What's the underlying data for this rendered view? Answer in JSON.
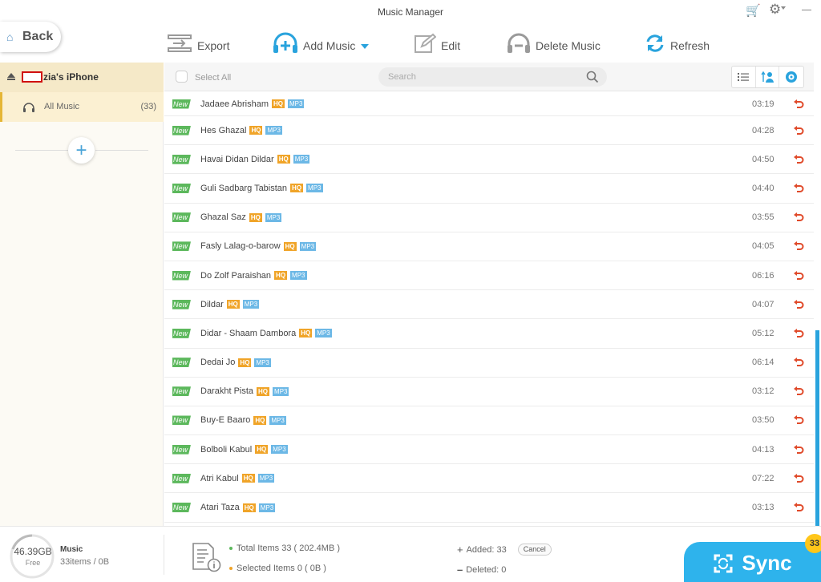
{
  "window": {
    "title": "Music Manager"
  },
  "nav": {
    "back_label": "Back"
  },
  "toolbar": {
    "export_label": "Export",
    "add_music_label": "Add Music",
    "edit_label": "Edit",
    "delete_music_label": "Delete Music",
    "refresh_label": "Refresh"
  },
  "sidebar": {
    "device_name": "zia's iPhone",
    "category_label": "All Music",
    "category_count": "(33)"
  },
  "list_header": {
    "select_all_label": "Select All",
    "search_placeholder": "Search"
  },
  "badges": {
    "new": "New",
    "hq": "HQ",
    "mp3": "MP3"
  },
  "songs": [
    {
      "title": "Jadaee Abrisham",
      "duration": "03:19"
    },
    {
      "title": "Hes Ghazal",
      "duration": "04:28"
    },
    {
      "title": "Havai Didan Dildar",
      "duration": "04:50"
    },
    {
      "title": "Guli Sadbarg Tabistan",
      "duration": "04:40"
    },
    {
      "title": "Ghazal Saz",
      "duration": "03:55"
    },
    {
      "title": "Fasly Lalag-o-barow",
      "duration": "04:05"
    },
    {
      "title": "Do Zolf Paraishan",
      "duration": "06:16"
    },
    {
      "title": "Dildar",
      "duration": "04:07"
    },
    {
      "title": "Didar - Shaam Dambora",
      "duration": "05:12"
    },
    {
      "title": "Dedai Jo",
      "duration": "06:14"
    },
    {
      "title": "Darakht Pista",
      "duration": "03:12"
    },
    {
      "title": "Buy-E Baaro",
      "duration": "03:50"
    },
    {
      "title": "Bolboli Kabul",
      "duration": "04:13"
    },
    {
      "title": "Atri Kabul",
      "duration": "07:22"
    },
    {
      "title": "Atari Taza",
      "duration": "03:13"
    }
  ],
  "footer": {
    "storage_amount": "46.39GB",
    "storage_label": "Free",
    "music_title": "Music",
    "music_sub": "33items / 0B",
    "total_items": "Total Items 33 ( 202.4MB )",
    "selected_items": "Selected Items 0 ( 0B )",
    "added": "Added: 33",
    "cancel_label": "Cancel",
    "deleted": "Deleted: 0",
    "sync_label": "Sync",
    "sync_badge": "33"
  },
  "colors": {
    "accent_blue": "#2eb3ec",
    "sidebar_active": "#fbf0d2",
    "new_badge": "#5cb85c",
    "hq_badge": "#f0a428",
    "mp3_badge": "#6cb8e6",
    "restore_red": "#e04a2a",
    "sync_badge": "#ffc61a"
  }
}
